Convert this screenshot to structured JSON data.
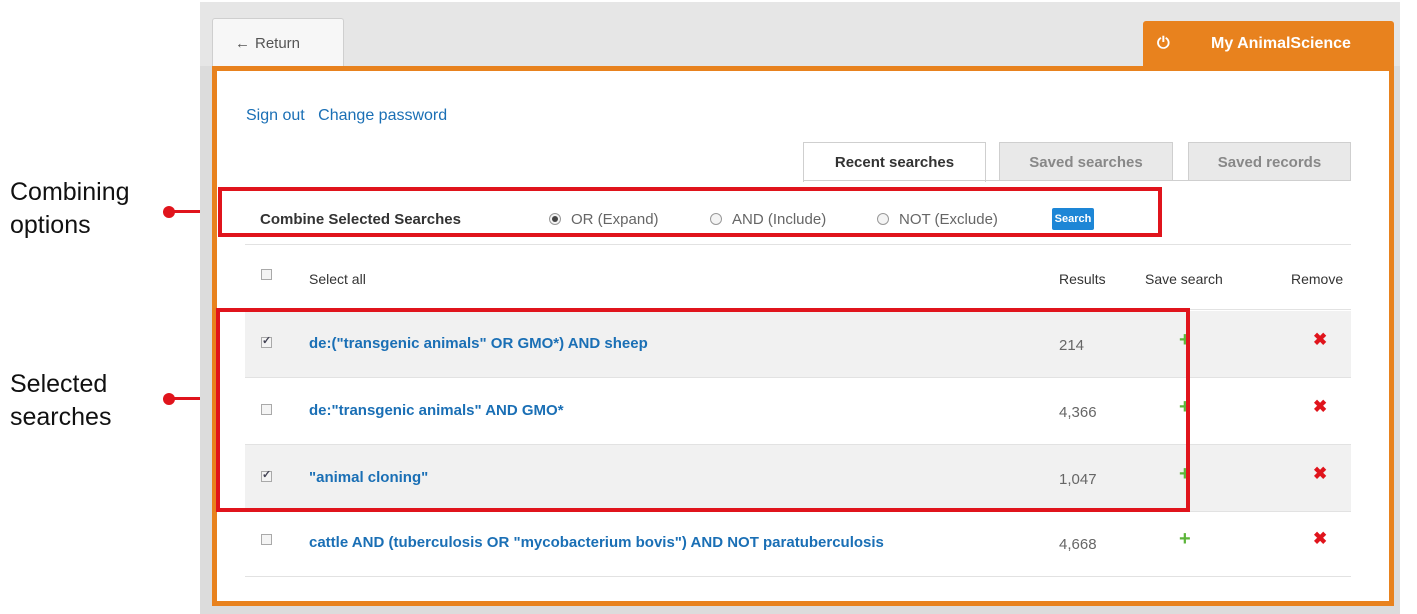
{
  "annotations": {
    "combining": [
      "Combining",
      "options"
    ],
    "selected": [
      "Selected",
      "searches"
    ]
  },
  "header": {
    "return_label": "Return",
    "return_icon": "←",
    "my_tab_label": "My AnimalScience",
    "my_tab_icon": "⏻"
  },
  "account_links": [
    "Sign out",
    "Change password"
  ],
  "tabs": [
    {
      "label": "Recent searches",
      "active": true
    },
    {
      "label": "Saved searches",
      "active": false
    },
    {
      "label": "Saved records",
      "active": false
    }
  ],
  "combine": {
    "label": "Combine Selected Searches",
    "options": [
      {
        "label": "OR (Expand)",
        "selected": true
      },
      {
        "label": "AND (Include)",
        "selected": false
      },
      {
        "label": "NOT (Exclude)",
        "selected": false
      }
    ],
    "button": "Search"
  },
  "table": {
    "headers": {
      "select_all": "Select all",
      "results": "Results",
      "save": "Save search",
      "remove": "Remove"
    },
    "rows": [
      {
        "query": "de:(\"transgenic animals\" OR GMO*) AND sheep",
        "results": "214",
        "checked": true
      },
      {
        "query": "de:\"transgenic animals\" AND GMO*",
        "results": "4,366",
        "checked": false
      },
      {
        "query": "\"animal cloning\"",
        "results": "1,047",
        "checked": true
      },
      {
        "query": "cattle AND (tuberculosis OR \"mycobacterium bovis\") AND NOT paratuberculosis",
        "results": "4,668",
        "checked": false
      }
    ],
    "save_icon": "+",
    "remove_icon": "✖"
  },
  "colors": {
    "accent": "#e8821e",
    "link": "#1a6fb5",
    "annotation": "#e0141c",
    "save": "#5db53a"
  }
}
